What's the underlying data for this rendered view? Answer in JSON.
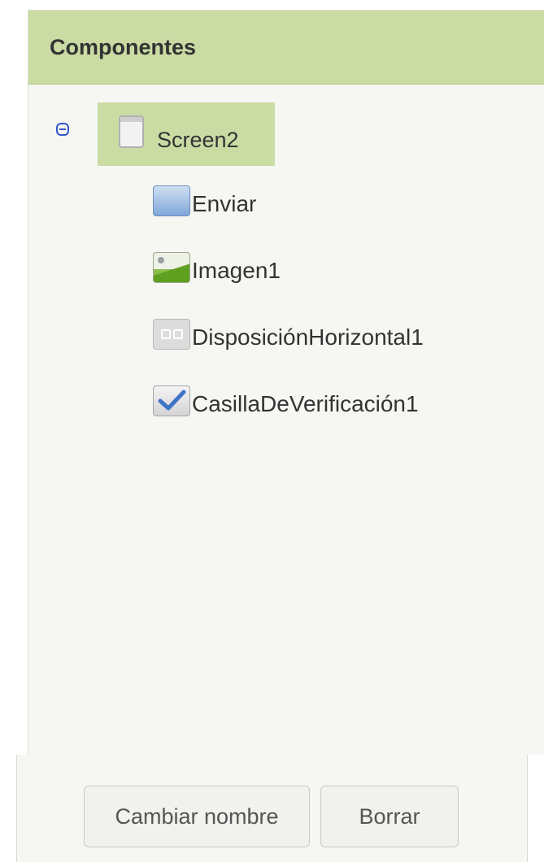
{
  "panel": {
    "title": "Componentes"
  },
  "tree": {
    "root": {
      "label": "Screen2",
      "icon": "screen-icon",
      "expanded": true
    },
    "children": [
      {
        "label": "Enviar",
        "icon": "button-icon"
      },
      {
        "label": "Imagen1",
        "icon": "image-icon"
      },
      {
        "label": "DisposiciónHorizontal1",
        "icon": "horizontal-arrangement-icon"
      },
      {
        "label": "CasillaDeVerificación1",
        "icon": "checkbox-icon"
      }
    ]
  },
  "actions": {
    "rename_label": "Cambiar nombre",
    "delete_label": "Borrar"
  },
  "colors": {
    "header_bg": "#cadca4",
    "selected_bg": "#cadca4",
    "panel_bg": "#f6f7f2",
    "toggle": "#3355cc"
  }
}
